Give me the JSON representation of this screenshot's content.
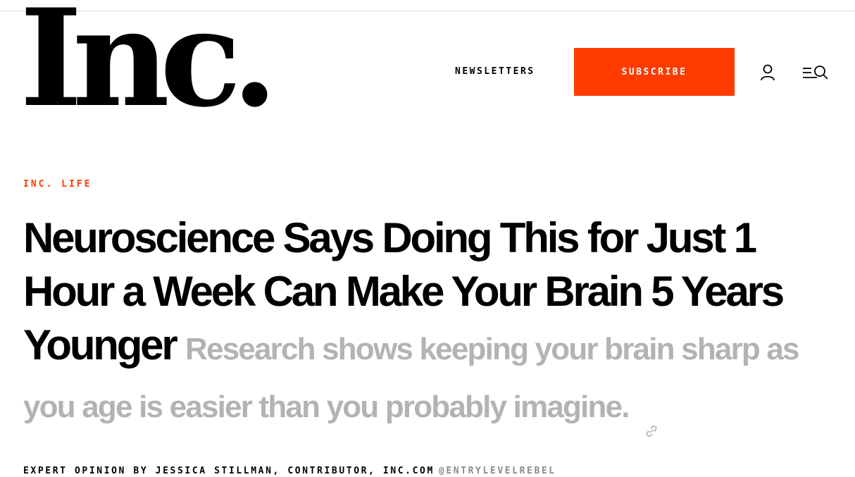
{
  "header": {
    "logo_text": "Inc.",
    "newsletters_label": "NEWSLETTERS",
    "subscribe_label": "SUBSCRIBE",
    "user_icon": "user-icon",
    "menu_search_icon": "menu-search-icon"
  },
  "article": {
    "kicker": "INC. LIFE",
    "title": "Neuroscience Says Doing This for Just 1 Hour a Week Can Make Your Brain 5 Years Younger",
    "dek": "Research shows keeping your brain sharp as you age is easier than you probably imagine.",
    "link_icon": "link-icon",
    "byline": "EXPERT OPINION BY JESSICA STILLMAN, CONTRIBUTOR, INC.COM",
    "author_handle": "@ENTRYLEVELREBEL"
  },
  "colors": {
    "accent": "#ff3b00",
    "dek_gray": "#b3b3b3",
    "handle_gray": "#8c8c8c",
    "text": "#000000"
  }
}
